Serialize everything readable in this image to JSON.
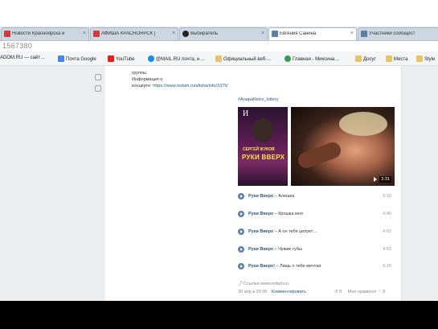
{
  "tabs": [
    {
      "title": "Новости Красноярска и",
      "favicon_color": "#d23b3b"
    },
    {
      "title": "АФИША КРАСНОЯРСК |",
      "favicon_color": "#d23b3b"
    },
    {
      "title": "Выбиратель",
      "favicon_color": "#222222"
    },
    {
      "title": "Евгения Санина",
      "favicon_color": "#5b7fa6"
    },
    {
      "title": "Участники сообщест",
      "favicon_color": "#5b7fa6"
    }
  ],
  "url_fragment": "1567380",
  "bookmarks": [
    {
      "label": "ADOM.RU — сайт…",
      "icon": "folder-icon"
    },
    {
      "label": "Почта Google",
      "icon": "mail-icon"
    },
    {
      "label": "YouTube",
      "icon": "youtube-icon"
    },
    {
      "label": "@MAIL.RU почта, н…",
      "icon": "mailru-icon"
    },
    {
      "label": "Официальный веб-…",
      "icon": "folder-icon"
    },
    {
      "label": "Главная - Миксина…",
      "icon": "globe-icon"
    },
    {
      "label": "Досуг",
      "icon": "folder-icon"
    },
    {
      "label": "Места",
      "icon": "folder-icon"
    },
    {
      "label": "Style",
      "icon": "folder-icon"
    }
  ],
  "post": {
    "line1": "группы.",
    "line2": "Информация о",
    "line3_label": "концерте:",
    "concert_link": "https://www.redam.ru/afisha/info/3375/",
    "hashtag": "#AnapaRetro_lottery",
    "poster_number": "И",
    "poster_name1": "СЕРГЕЙ ЖУКОВ",
    "poster_name2": "РУКИ ВВЕРХ",
    "video_duration": "3:31",
    "tracks": [
      {
        "artist": "Руки Вверх",
        "title": "Алешка",
        "duration": "5:20"
      },
      {
        "artist": "Руки Вверх",
        "title": "Крошка моя",
        "duration": "4:40"
      },
      {
        "artist": "Руки Вверх",
        "title": "А он тебя целует…",
        "duration": "4:02"
      },
      {
        "artist": "Руки Вверх",
        "title": "Чужие губы",
        "duration": "4:03"
      },
      {
        "artist": "Руки Вверх!",
        "title": "Лишь о тебе мечтая",
        "duration": "5:20"
      }
    ],
    "source_link": "Ссылка www.redam.ru",
    "date": "30 апр в 20:00",
    "comment_label": "Комментировать",
    "likes": "8",
    "reposts_label": "Мне нравится",
    "reposts": "8"
  },
  "colors": {
    "accent": "#5e81a8",
    "link": "#2a5885",
    "page_bg": "#edeef0"
  }
}
